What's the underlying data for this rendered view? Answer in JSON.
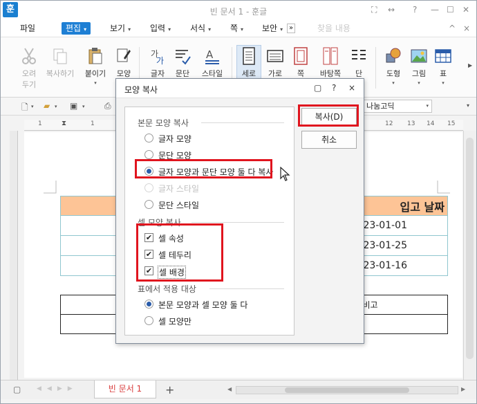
{
  "titlebar": {
    "app_icon": "훈",
    "title": "빈 문서 1 - 훈글",
    "controls": [
      "⛶",
      "↔",
      "?",
      "—",
      "☐",
      "✕"
    ]
  },
  "menubar": {
    "items": [
      {
        "label": "파일",
        "arrow": ""
      },
      {
        "label": "편집",
        "arrow": "▾"
      },
      {
        "label": "보기",
        "arrow": "▾"
      },
      {
        "label": "입력",
        "arrow": "▾"
      },
      {
        "label": "서식",
        "arrow": "▾"
      },
      {
        "label": "쪽",
        "arrow": "▾"
      },
      {
        "label": "보안",
        "arrow": "▾"
      }
    ],
    "more": "»",
    "search_placeholder": "찾을 내용",
    "right_icons": [
      "^",
      "×"
    ]
  },
  "ribbon": {
    "buttons": [
      {
        "label": "오려\n두기",
        "icon": "scissors-icon",
        "dim": true
      },
      {
        "label": "복사하기",
        "icon": "copy-icon",
        "dim": true
      },
      {
        "label": "붙이기",
        "icon": "paste-icon",
        "dim": false
      },
      {
        "label": "모양",
        "icon": "brush-icon",
        "dim": false
      },
      {
        "label": "글자",
        "icon": "char-shape-icon",
        "dim": false
      },
      {
        "label": "문단",
        "icon": "paragraph-icon",
        "dim": false
      },
      {
        "label": "스타일",
        "icon": "style-icon",
        "dim": false
      },
      {
        "label": "세로",
        "icon": "portrait-icon",
        "dim": false
      },
      {
        "label": "가로",
        "icon": "landscape-icon",
        "dim": false
      },
      {
        "label": "쪽",
        "icon": "page-icon",
        "dim": false
      },
      {
        "label": "바탕쪽",
        "icon": "master-page-icon",
        "dim": false
      },
      {
        "label": "단",
        "icon": "column-icon",
        "dim": false
      },
      {
        "label": "도형",
        "icon": "shape-icon",
        "dim": false
      },
      {
        "label": "그림",
        "icon": "picture-icon",
        "dim": false
      },
      {
        "label": "표",
        "icon": "table-icon",
        "dim": false
      }
    ]
  },
  "toolbar2": {
    "font_name": "나눔고딕"
  },
  "ruler": {
    "numbers": [
      "1",
      "1",
      "12",
      "13",
      "14",
      "15"
    ]
  },
  "document": {
    "table1": {
      "header_left": "",
      "header_right": "입고 날짜",
      "rows": [
        "2023-01-01",
        "2023-01-25",
        "2023-01-16"
      ]
    },
    "table2": {
      "cell": "비고"
    }
  },
  "bottombar": {
    "tab": "빈 문서 1",
    "add": "+"
  },
  "dialog": {
    "title": "모양 복사",
    "controls": [
      "▢",
      "?",
      "×"
    ],
    "section1_title": "본문 모양 복사",
    "section1_options": [
      {
        "label": "글자 모양",
        "selected": false,
        "disabled": false
      },
      {
        "label": "문단 모양",
        "selected": false,
        "disabled": false
      },
      {
        "label": "글자 모양과 문단 모양 둘 다 복사",
        "selected": true,
        "disabled": false
      },
      {
        "label": "글자 스타일",
        "selected": false,
        "disabled": true
      },
      {
        "label": "문단 스타일",
        "selected": false,
        "disabled": false
      }
    ],
    "section2_title": "셀 모양 복사",
    "section2_options": [
      {
        "label": "셀 속성",
        "checked": true
      },
      {
        "label": "셀 테두리",
        "checked": true
      },
      {
        "label": "셀 배경",
        "checked": true
      }
    ],
    "section3_title": "표에서 적용 대상",
    "section3_options": [
      {
        "label": "본문 모양과 셀 모양 둘 다",
        "selected": true
      },
      {
        "label": "셀 모양만",
        "selected": false
      }
    ],
    "copy_button": "복사(D)",
    "cancel_button": "취소"
  },
  "colors": {
    "accent": "#1e7fd4",
    "highlight": "#e0141e",
    "table_header": "#fdc496",
    "tab_text": "#d83c3c"
  }
}
